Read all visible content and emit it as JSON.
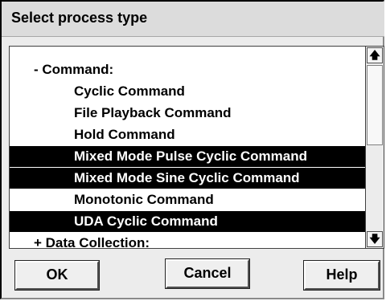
{
  "dialog": {
    "title": "Select process type"
  },
  "list": {
    "items": [
      {
        "label": "- Command:",
        "kind": "group",
        "selected": false
      },
      {
        "label": "Cyclic Command",
        "kind": "child",
        "selected": false
      },
      {
        "label": "File Playback Command",
        "kind": "child",
        "selected": false
      },
      {
        "label": "Hold Command",
        "kind": "child",
        "selected": false
      },
      {
        "label": "Mixed Mode Pulse Cyclic Command",
        "kind": "child",
        "selected": true
      },
      {
        "label": "Mixed Mode Sine Cyclic Command",
        "kind": "child",
        "selected": true
      },
      {
        "label": "Monotonic Command",
        "kind": "child",
        "selected": false
      },
      {
        "label": "UDA Cyclic Command",
        "kind": "child",
        "selected": true
      },
      {
        "label": "+ Data Collection:",
        "kind": "group",
        "selected": false
      }
    ]
  },
  "scrollbar": {
    "up_icon": "arrow-up",
    "down_icon": "arrow-down",
    "up_glyph": "🡅",
    "down_glyph": "🡇"
  },
  "buttons": {
    "ok_label": "OK",
    "cancel_label": "Cancel",
    "help_label": "Help"
  },
  "colors": {
    "selection_background": "#000000",
    "selection_text": "#ffffff",
    "dialog_background": "#ececec"
  }
}
